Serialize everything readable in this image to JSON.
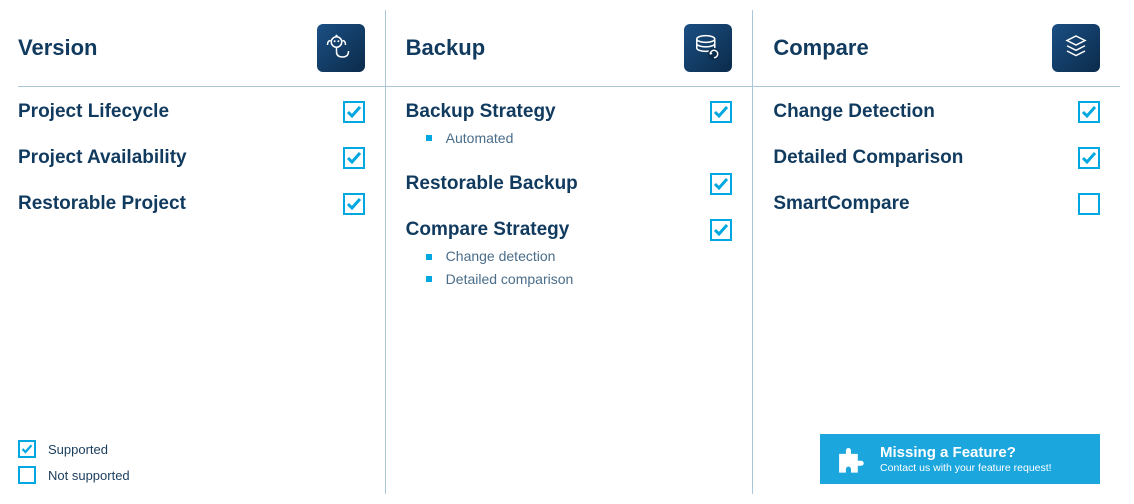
{
  "columns": [
    {
      "title": "Version",
      "icon": "version-icon",
      "features": [
        {
          "label": "Project Lifecycle",
          "supported": true,
          "subitems": []
        },
        {
          "label": "Project Availability",
          "supported": true,
          "subitems": []
        },
        {
          "label": "Restorable Project",
          "supported": true,
          "subitems": []
        }
      ]
    },
    {
      "title": "Backup",
      "icon": "backup-icon",
      "features": [
        {
          "label": "Backup Strategy",
          "supported": true,
          "subitems": [
            "Automated"
          ]
        },
        {
          "label": "Restorable Backup",
          "supported": true,
          "subitems": []
        },
        {
          "label": "Compare Strategy",
          "supported": true,
          "subitems": [
            "Change detection",
            "Detailed comparison"
          ]
        }
      ]
    },
    {
      "title": "Compare",
      "icon": "compare-icon",
      "features": [
        {
          "label": "Change Detection",
          "supported": true,
          "subitems": []
        },
        {
          "label": "Detailed Comparison",
          "supported": true,
          "subitems": []
        },
        {
          "label": "SmartCompare",
          "supported": false,
          "subitems": []
        }
      ]
    }
  ],
  "legend": {
    "supported": "Supported",
    "not_supported": "Not supported"
  },
  "cta": {
    "title": "Missing a Feature?",
    "subtitle": "Contact us with your feature request!"
  }
}
